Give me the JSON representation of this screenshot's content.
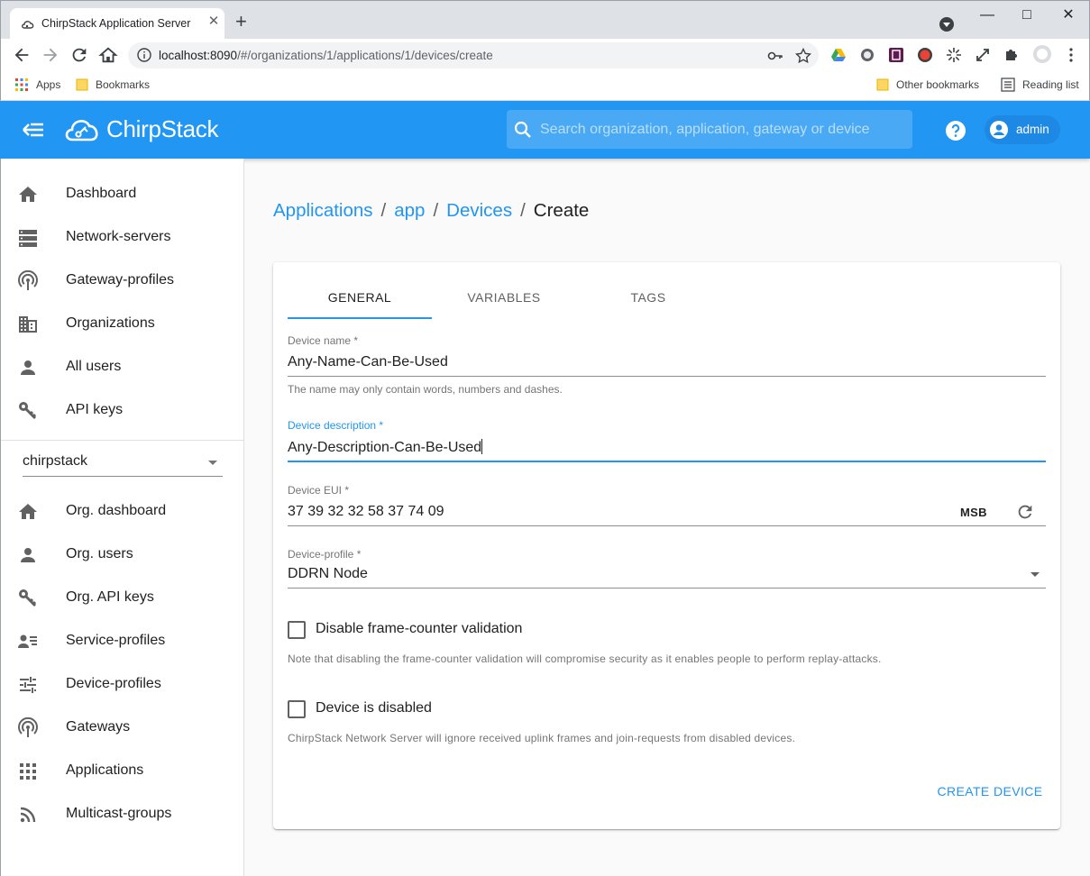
{
  "browser": {
    "tab_title": "ChirpStack Application Server",
    "url_host": "localhost:8090",
    "url_path": "/#/organizations/1/applications/1/devices/create",
    "bookmarks": {
      "apps": "Apps",
      "bookmarks": "Bookmarks",
      "other": "Other bookmarks",
      "reading_list": "Reading list"
    }
  },
  "appbar": {
    "brand": "ChirpStack",
    "search_placeholder": "Search organization, application, gateway or device",
    "username": "admin",
    "color": "#2196f3"
  },
  "sidebar": {
    "global_items": [
      {
        "label": "Dashboard",
        "icon": "home-icon"
      },
      {
        "label": "Network-servers",
        "icon": "server-icon"
      },
      {
        "label": "Gateway-profiles",
        "icon": "antenna-icon"
      },
      {
        "label": "Organizations",
        "icon": "building-icon"
      },
      {
        "label": "All users",
        "icon": "person-icon"
      },
      {
        "label": "API keys",
        "icon": "key-icon"
      }
    ],
    "organization": "chirpstack",
    "org_items": [
      {
        "label": "Org. dashboard",
        "icon": "home-icon"
      },
      {
        "label": "Org. users",
        "icon": "person-icon"
      },
      {
        "label": "Org. API keys",
        "icon": "key-icon"
      },
      {
        "label": "Service-profiles",
        "icon": "account-details-icon"
      },
      {
        "label": "Device-profiles",
        "icon": "tune-icon"
      },
      {
        "label": "Gateways",
        "icon": "antenna-icon"
      },
      {
        "label": "Applications",
        "icon": "grid-icon"
      },
      {
        "label": "Multicast-groups",
        "icon": "rss-icon"
      }
    ]
  },
  "breadcrumb": [
    "Applications",
    "app",
    "Devices",
    "Create"
  ],
  "tabs": [
    "GENERAL",
    "VARIABLES",
    "TAGS"
  ],
  "form": {
    "device_name": {
      "label": "Device name *",
      "value": "Any-Name-Can-Be-Used",
      "help": "The name may only contain words, numbers and dashes."
    },
    "device_description": {
      "label": "Device description *",
      "value": "Any-Description-Can-Be-Used"
    },
    "device_eui": {
      "label": "Device EUI *",
      "value": "37 39 32 32 58 37 74 09",
      "byte_order": "MSB"
    },
    "device_profile": {
      "label": "Device-profile *",
      "value": "DDRN Node"
    },
    "disable_fcnt": {
      "label": "Disable frame-counter validation",
      "checked": false,
      "note": "Note that disabling the frame-counter validation will compromise security as it enables people to perform replay-attacks."
    },
    "device_disabled": {
      "label": "Device is disabled",
      "checked": false,
      "note": "ChirpStack Network Server will ignore received uplink frames and join-requests from disabled devices."
    },
    "submit_label": "CREATE DEVICE"
  }
}
